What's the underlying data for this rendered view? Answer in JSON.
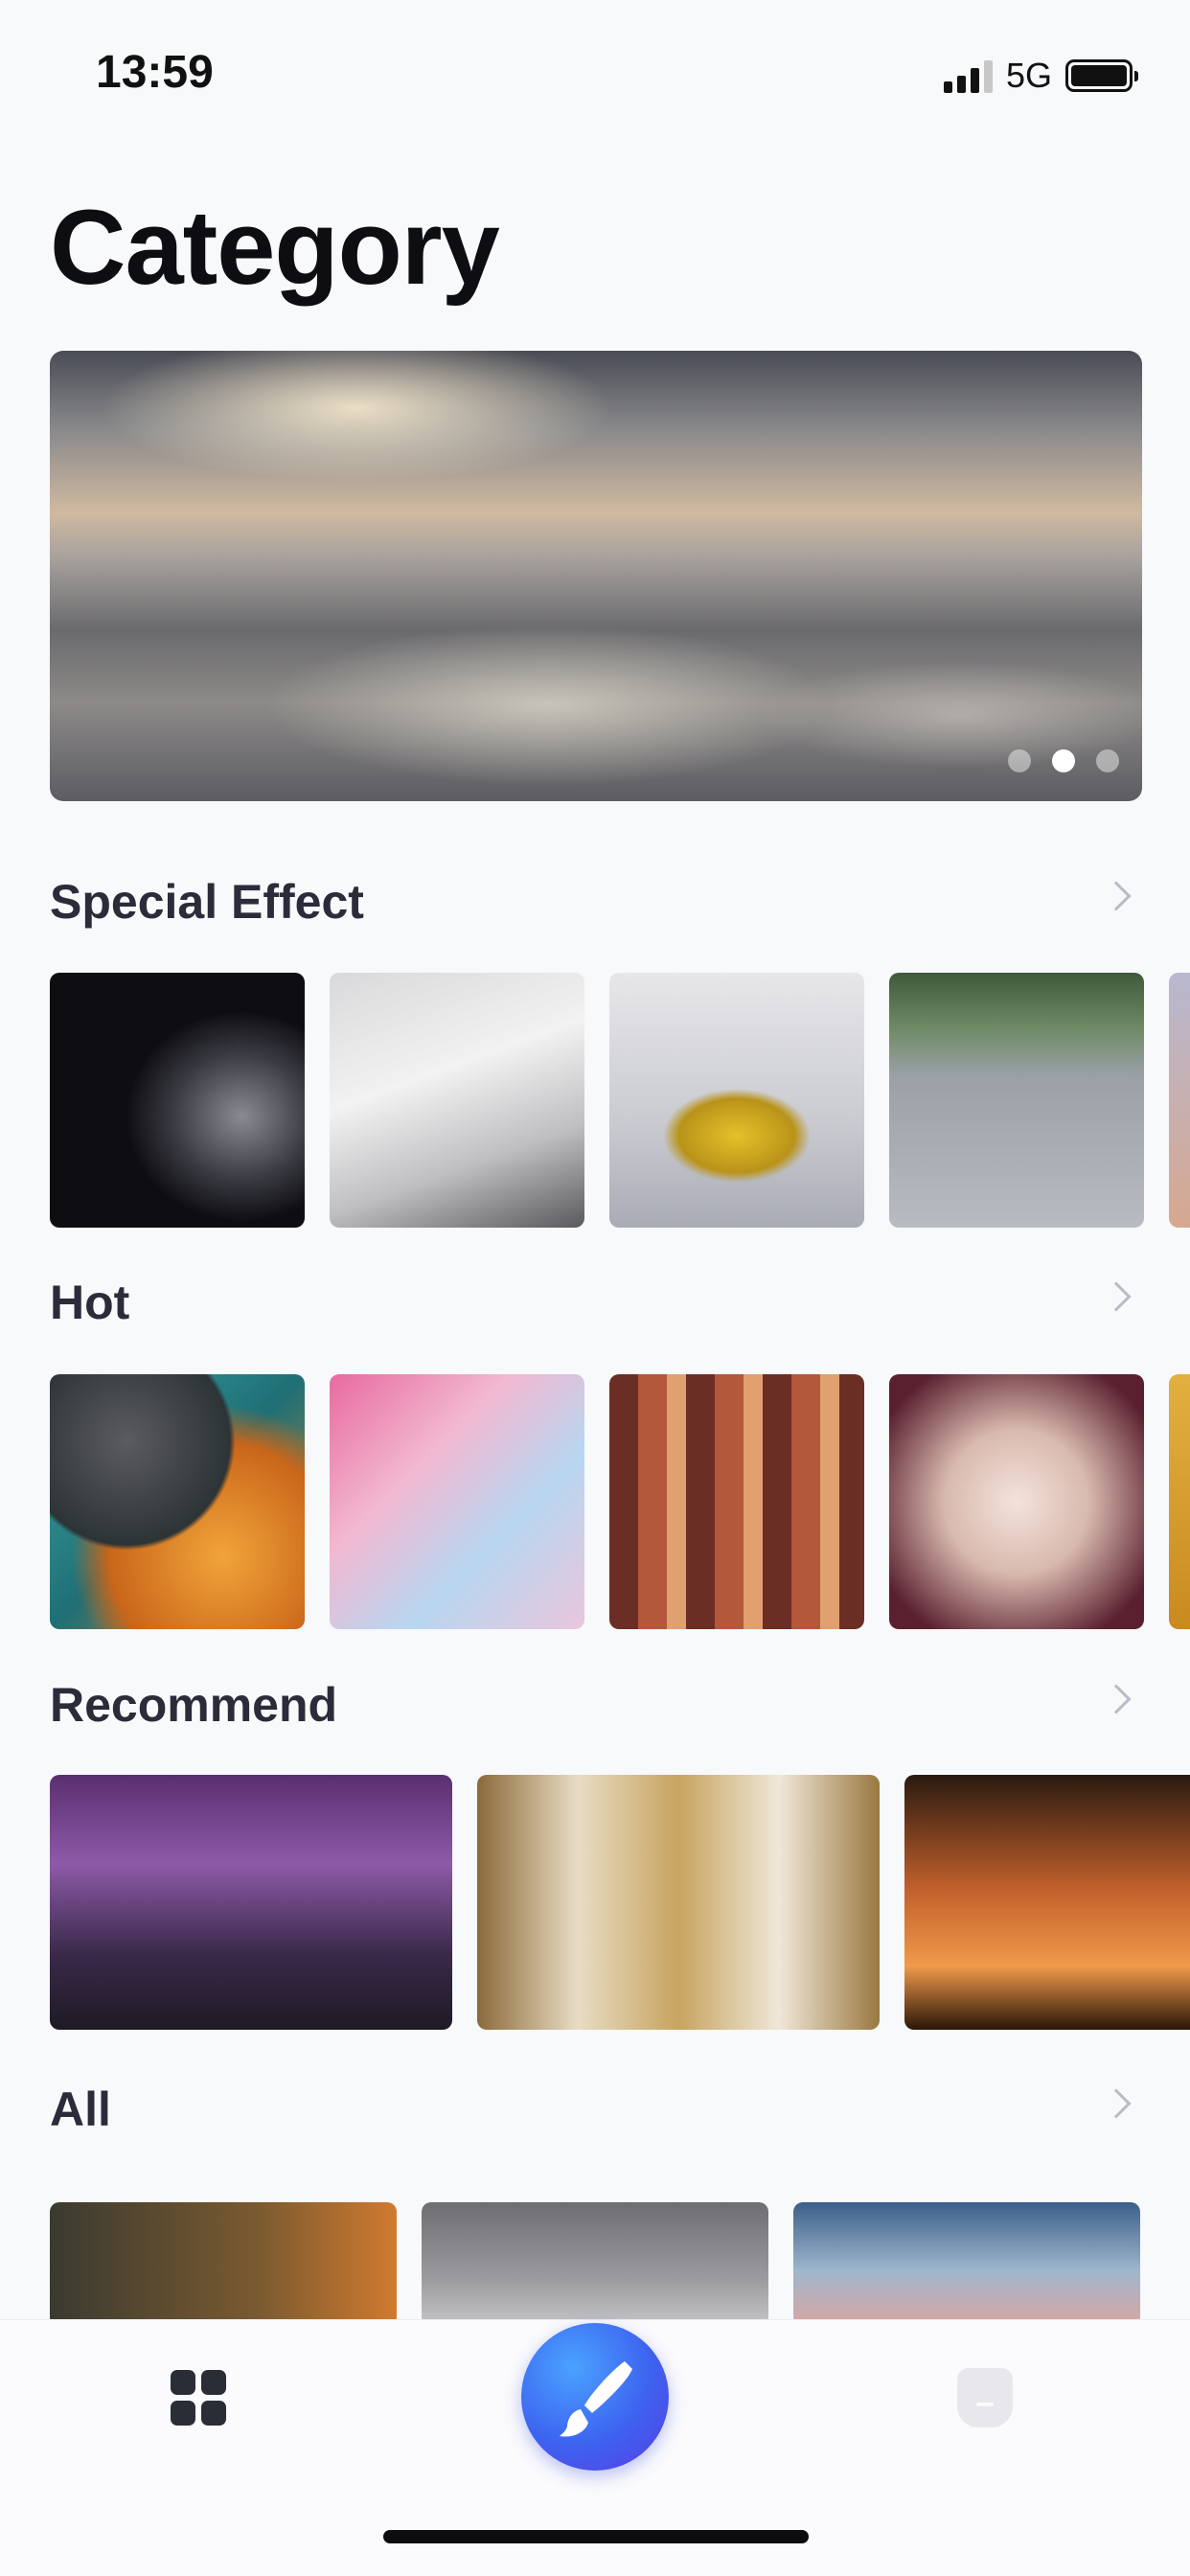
{
  "status_bar": {
    "time": "13:59",
    "network": "5G"
  },
  "page_title": "Category",
  "banner": {
    "slide_count": 3,
    "active_slide": 2
  },
  "sections": [
    {
      "label": "Special Effect"
    },
    {
      "label": "Hot"
    },
    {
      "label": "Recommend"
    },
    {
      "label": "All"
    }
  ],
  "tab_bar": {
    "items": [
      {
        "icon": "grid-icon",
        "selected": true
      },
      {
        "icon": "brush-icon"
      },
      {
        "icon": "profile-icon"
      }
    ]
  }
}
